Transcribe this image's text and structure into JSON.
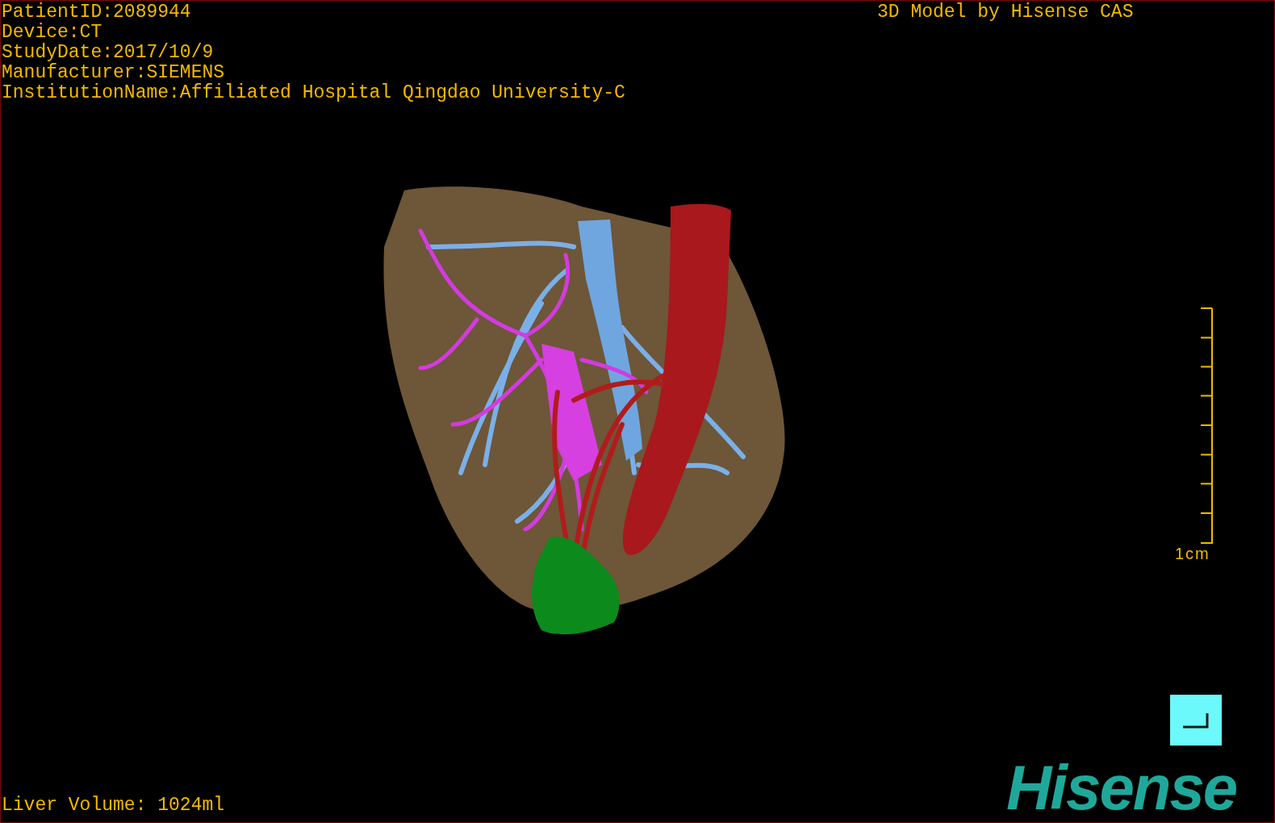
{
  "info_lines": [
    "PatientID:2089944",
    "Device:CT",
    "StudyDate:2017/10/9",
    "Manufacturer:SIEMENS",
    "InstitutionName:Affiliated Hospital Qingdao University-C"
  ],
  "title": "3D Model by Hisense CAS",
  "scale_bar": {
    "label": "1cm"
  },
  "liver_volume": "Liver Volume: 1024ml",
  "logo": "Hisense"
}
